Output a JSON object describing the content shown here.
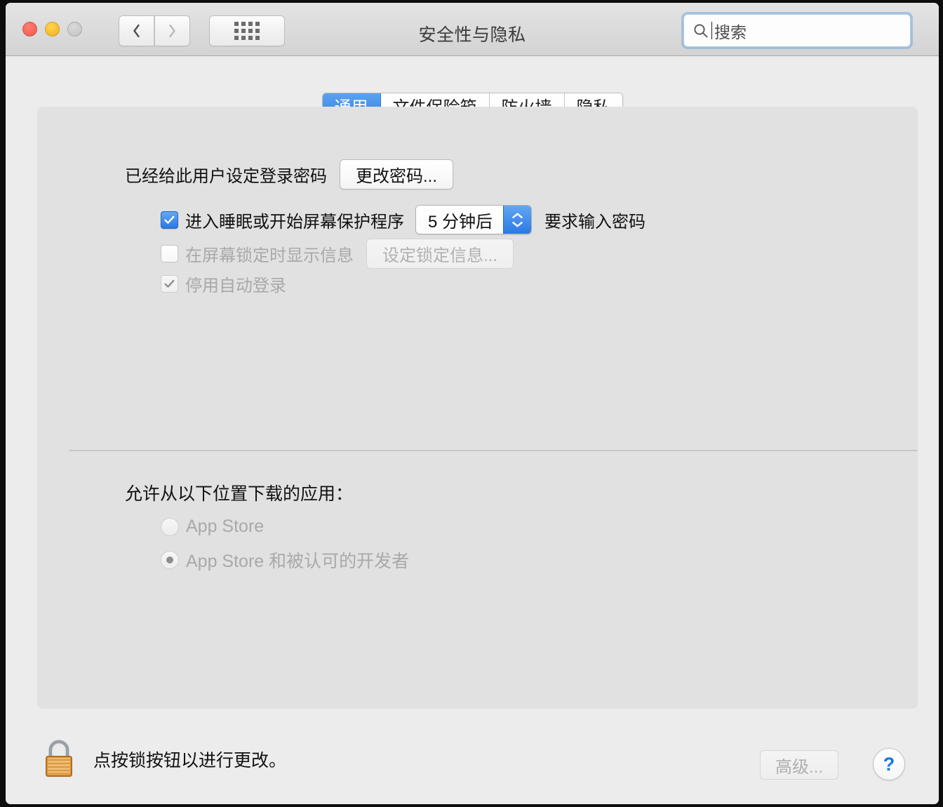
{
  "window": {
    "title": "安全性与隐私",
    "traffic_lights": {
      "close_color": "#f2564a",
      "minimize_color": "#f2b01e",
      "zoom_color": "#c3c3c3"
    }
  },
  "toolbar": {
    "back_label": "",
    "forward_label": "",
    "show_all_label": ""
  },
  "search": {
    "placeholder": "搜索",
    "value": "",
    "focused": true,
    "accent": "#69a5e0"
  },
  "tabs": [
    {
      "label": "通用",
      "active": true
    },
    {
      "label": "文件保险箱",
      "active": false
    },
    {
      "label": "防火墙",
      "active": false
    },
    {
      "label": "隐私",
      "active": false
    }
  ],
  "general": {
    "password_label": "已经给此用户设定登录密码",
    "change_password_button": "更改密码...",
    "require_password": {
      "checked": true,
      "enabled": true,
      "label": "进入睡眠或开始屏幕保护程序",
      "delay_value": "5 分钟后",
      "trailing_label": "要求输入密码"
    },
    "show_lock_message": {
      "checked": false,
      "enabled": false,
      "label": "在屏幕锁定时显示信息",
      "button": "设定锁定信息..."
    },
    "disable_auto_login": {
      "checked": true,
      "enabled": false,
      "label": "停用自动登录"
    }
  },
  "downloads": {
    "title": "允许从以下位置下载的应用：",
    "options": [
      {
        "label": "App Store",
        "selected": false,
        "enabled": false
      },
      {
        "label": "App Store 和被认可的开发者",
        "selected": true,
        "enabled": false
      }
    ]
  },
  "footer": {
    "lock_text": "点按锁按钮以进行更改。",
    "lock_state": "locked",
    "advanced_button": "高级...",
    "advanced_enabled": false,
    "help_button": "?",
    "help_color": "#1576e8"
  }
}
